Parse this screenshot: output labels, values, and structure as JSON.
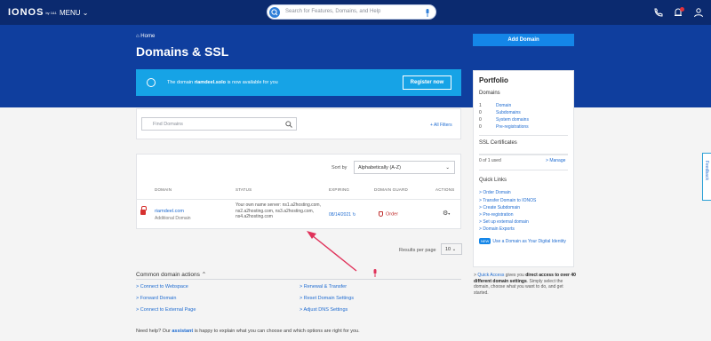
{
  "topbar": {
    "logo": "IONOS",
    "logo_sub": "by 1&1",
    "menu_label": "MENU",
    "search_placeholder": "Search for Features, Domains, and Help",
    "notif_count": "1"
  },
  "hero": {
    "breadcrumb": "Home",
    "title": "Domains & SSL",
    "add_domain": "Add Domain"
  },
  "banner": {
    "text_prefix": "The domain ",
    "domain": "riamdeel.solo",
    "text_suffix": " is now available for you",
    "button": "Register now"
  },
  "filters": {
    "find_placeholder": "Find Domains",
    "all_filters": "+ All Filters"
  },
  "table": {
    "sort_label": "Sort by",
    "sort_value": "Alphabetically (A-Z)",
    "headers": [
      "DOMAIN",
      "STATUS",
      "EXPIRING",
      "DOMAIN GUARD",
      "ACTIONS"
    ],
    "rows": [
      {
        "domain": "riamdeel.com",
        "type": "Additional Domain",
        "status": "Your own name server: ns1.a2hosting.com, ns2.a2hosting.com, ns3.a2hosting.com, ns4.a2hosting.com",
        "expiring": "08/14/2021",
        "guard": "Order"
      }
    ],
    "results_label": "Results per page",
    "results_value": "10"
  },
  "common_actions": {
    "title": "Common domain actions",
    "links": [
      "Connect to Webspace",
      "Forward Domain",
      "Connect to External Page",
      "Renewal & Transfer",
      "Reset Domain Settings",
      "Adjust DNS Settings"
    ]
  },
  "help_text": {
    "prefix": "Need help? Our ",
    "assistant": "assistant",
    "suffix": " is happy to explain what you can choose and which options are right for you."
  },
  "portfolio": {
    "title": "Portfolio",
    "domains_label": "Domains",
    "domains": [
      {
        "count": "1",
        "label": "Domain"
      },
      {
        "count": "0",
        "label": "Subdomains"
      },
      {
        "count": "0",
        "label": "System domains"
      },
      {
        "count": "0",
        "label": "Pre-registrations"
      }
    ],
    "ssl_label": "SSL Certificates",
    "ssl_used": "0 of 1 used",
    "ssl_manage": "Manage",
    "quick_links_label": "Quick Links",
    "quick_links": [
      "Order Domain",
      "Transfer Domain to IONOS",
      "Create Subdomain",
      "Pre-registration",
      "Set up external domain",
      "Domain Exports"
    ],
    "digital_identity_badge": "NEW",
    "digital_identity": "Use a Domain as Your Digital Identity"
  },
  "quick_access": {
    "link": "Quick Access",
    "text1": " gives you ",
    "bold": "direct access to over 40 different domain settings",
    "text2": ". Simply select the domain, choose what you want to do, and get started."
  },
  "feedback": "Feedback",
  "colors": {
    "nav": "#0b2a6f",
    "hero": "#0f3e9e",
    "banner": "#16a3e6",
    "accent": "#1486e8",
    "link": "#1f6cd1",
    "alert": "#d6312f"
  }
}
